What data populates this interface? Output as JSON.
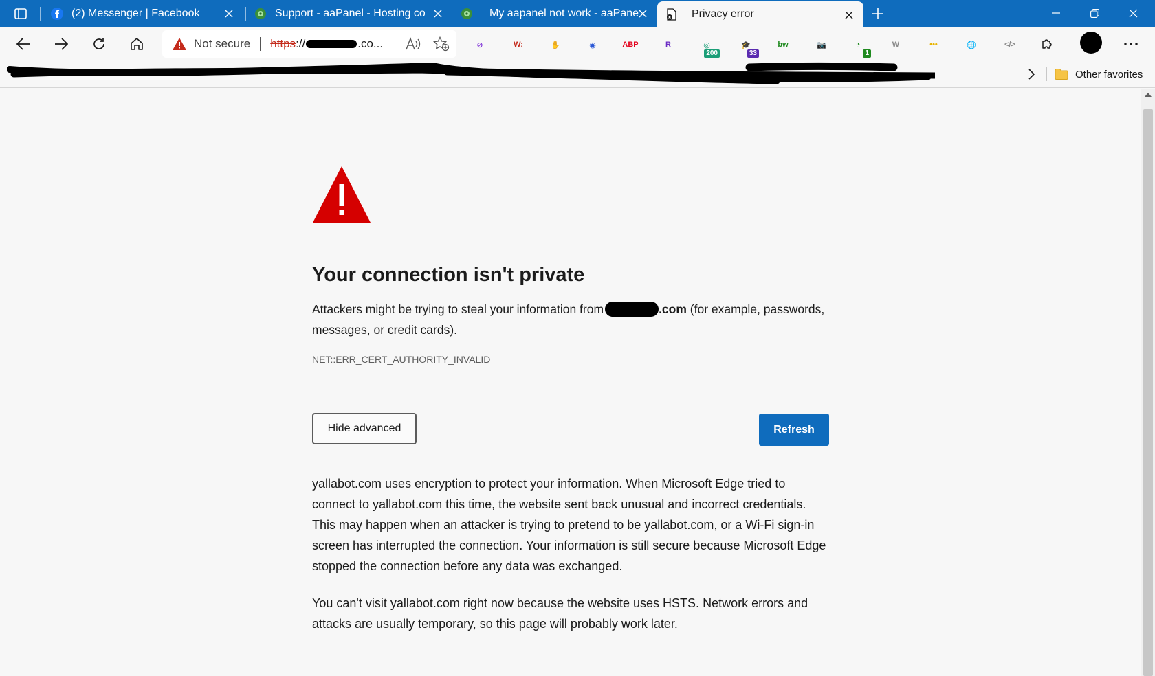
{
  "tabs": [
    {
      "title": "(2) Messenger | Facebook",
      "icon": "facebook-icon",
      "active": false
    },
    {
      "title": "Support - aaPanel - Hosting cont",
      "icon": "aapanel-icon",
      "active": false
    },
    {
      "title": "My aapanel not work - aaPanel -",
      "icon": "aapanel-icon",
      "active": false
    },
    {
      "title": "Privacy error",
      "icon": "privacy-error-icon",
      "active": true
    }
  ],
  "addressbar": {
    "security_label": "Not secure",
    "url_scheme": "https",
    "url_rest": "://",
    "url_tail": ".co..."
  },
  "extensions": [
    {
      "name": "block-icon",
      "glyph": "⊘",
      "color": "#7a2bd6",
      "badge": ""
    },
    {
      "name": "w-extension-icon",
      "glyph": "W:",
      "color": "#c42b1c",
      "badge": ""
    },
    {
      "name": "adblock-icon",
      "glyph": "✋",
      "color": "#e3001b",
      "badge": ""
    },
    {
      "name": "color-picker-icon",
      "glyph": "◉",
      "color": "#2b58d6",
      "badge": ""
    },
    {
      "name": "abp-icon",
      "glyph": "ABP",
      "color": "#e3001b",
      "badge": ""
    },
    {
      "name": "r-extension-icon",
      "glyph": "R",
      "color": "#6b2bc4",
      "badge": ""
    },
    {
      "name": "seo-extension-icon",
      "glyph": "◎",
      "color": "#1b9e77",
      "badge": "200"
    },
    {
      "name": "graduation-cap-icon",
      "glyph": "🎓",
      "color": "#5a2bb0",
      "badge": "33"
    },
    {
      "name": "bw-extension-icon",
      "glyph": "bw",
      "color": "#1f8a1f",
      "badge": ""
    },
    {
      "name": "camera-icon",
      "glyph": "📷",
      "color": "#8a8a8a",
      "badge": ""
    },
    {
      "name": "timer-extension-icon",
      "glyph": "◔",
      "color": "#1f8a1f",
      "badge": "1"
    },
    {
      "name": "wordpress-icon",
      "glyph": "W",
      "color": "#8a8a8a",
      "badge": ""
    },
    {
      "name": "yellow-extension-icon",
      "glyph": "•••",
      "color": "#e8b400",
      "badge": ""
    },
    {
      "name": "globe-extension-icon",
      "glyph": "🌐",
      "color": "#2b8a3e",
      "badge": ""
    },
    {
      "name": "code-extension-icon",
      "glyph": "</>",
      "color": "#8a8a8a",
      "badge": ""
    }
  ],
  "bookmarks": {
    "other_favorites": "Other favorites"
  },
  "page": {
    "heading": "Your connection isn't private",
    "summary_before": "Attackers might be trying to steal your information from",
    "summary_domain_suffix": ".com",
    "summary_after": " (for example, passwords, messages, or credit cards).",
    "error_code": "NET::ERR_CERT_AUTHORITY_INVALID",
    "hide_advanced_label": "Hide advanced",
    "refresh_label": "Refresh",
    "details_1": "yallabot.com uses encryption to protect your information. When Microsoft Edge tried to connect to yallabot.com this time, the website sent back unusual and incorrect credentials. This may happen when an attacker is trying to pretend to be yallabot.com, or a Wi-Fi sign-in screen has interrupted the connection. Your information is still secure because Microsoft Edge stopped the connection before any data was exchanged.",
    "details_2": "You can't visit yallabot.com right now because the website uses HSTS. Network errors and attacks are usually temporary, so this page will probably work later."
  },
  "colors": {
    "accent": "#0f6cbd",
    "warning_red": "#c42b1c",
    "error_triangle": "#d50000"
  }
}
